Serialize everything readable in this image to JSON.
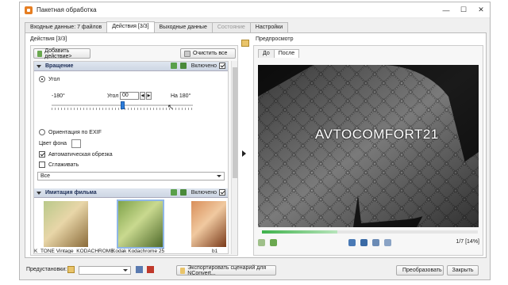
{
  "window": {
    "title": "Пакетная обработка",
    "controls": {
      "minimize": "—",
      "maximize": "☐",
      "close": "✕"
    }
  },
  "tabs": [
    {
      "label": "Входные данные: 7 файлов",
      "state": "normal"
    },
    {
      "label": "Действия [3/3]",
      "state": "active"
    },
    {
      "label": "Выходные данные",
      "state": "normal"
    },
    {
      "label": "Состояние",
      "state": "disabled"
    },
    {
      "label": "Настройки",
      "state": "normal"
    }
  ],
  "actions": {
    "section_label": "Действия [3/3]",
    "add_button": "Добавить действие>",
    "clear_button": "Очистить все",
    "rotation": {
      "title": "Вращение",
      "enabled_label": "Включено",
      "enabled": true,
      "angle_radio": "Угол",
      "angle_label": "Угол",
      "angle_value": "00",
      "min_label": "-180°",
      "max_label": "На 180°",
      "slider_fraction": 0.5,
      "exif_radio": "Ориентация по EXIF",
      "bg_color_label": "Цвет фона",
      "bg_color": "#ffffff",
      "auto_crop_label": "Автоматическая обрезка",
      "auto_crop": true,
      "smooth_label": "Сглаживать",
      "smooth": false,
      "scope_select": "Все"
    },
    "film": {
      "title": "Имитация фильма",
      "enabled_label": "Включено",
      "enabled": true,
      "presets": [
        {
          "caption": "K_TONE Vintage_KODACHROME"
        },
        {
          "caption": "Kodak Kodachrome 25"
        },
        {
          "caption": "b1"
        }
      ]
    }
  },
  "preview": {
    "section_label": "Предпросмотр",
    "tabs": [
      {
        "label": "До"
      },
      {
        "label": "После"
      }
    ],
    "watermark": "AVTOCOMFORT21",
    "counter": "1/7 [14%]",
    "progress_fraction": 0.35
  },
  "footer": {
    "presets_label": "Предустановки:",
    "export_button": "Экспортировать сценарий для NConvert...",
    "convert_button": "Преобразовать",
    "close_button": "Закрыть"
  },
  "icons": [
    "app-icon",
    "add-action-icon",
    "clear-icon",
    "move-up-icon",
    "move-down-icon",
    "slider-cursor-icon",
    "image-sidebar-icon",
    "nav-back-icon",
    "nav-forward-icon",
    "zoom-in-icon",
    "fit-icon",
    "zoom-reset-icon",
    "zoom-out-icon",
    "folder-icon",
    "save-icon",
    "delete-icon",
    "convert-icon"
  ]
}
